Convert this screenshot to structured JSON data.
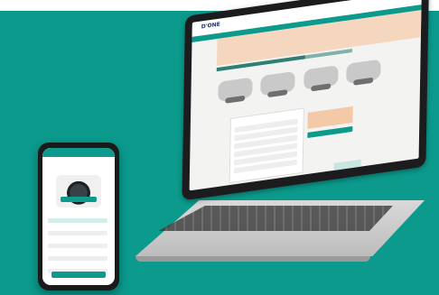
{
  "scene": {
    "background_color": "#0b9a8c",
    "accent_color": "#f5d7bf"
  },
  "laptop_site": {
    "logo": "D'ONE",
    "nav_icons": "● ● ●",
    "header_text": "",
    "section_title": "",
    "machine_labels": [
      "",
      "",
      "",
      ""
    ],
    "form_title": "",
    "progress": 0.65
  },
  "phone_app": {
    "title": "",
    "labels": [
      "",
      "",
      "",
      "",
      "",
      ""
    ]
  }
}
